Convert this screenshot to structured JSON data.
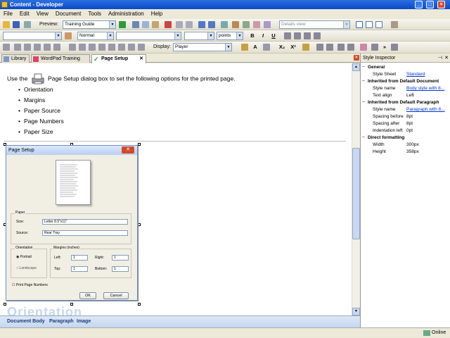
{
  "window": {
    "title": "Content - Developer"
  },
  "menu": [
    "File",
    "Edit",
    "View",
    "Document",
    "Tools",
    "Administration",
    "Help"
  ],
  "toolbar1": {
    "preview_label": "Preview:",
    "preview_value": "Training Guide",
    "view_value": "Details view"
  },
  "toolbar2": {
    "font_combo": "",
    "style_value": "Normal",
    "size_unit": "points"
  },
  "toolbar3": {
    "display_label": "Display:",
    "display_value": "Player",
    "bold": "B",
    "italic": "I",
    "underline": "U",
    "subscript": "X₂",
    "superscript": "X²"
  },
  "tabs": [
    {
      "label": "Library",
      "icon": "library-icon"
    },
    {
      "label": "WordPad Training",
      "icon": "wordpad-icon"
    },
    {
      "label": "Page Setup",
      "icon": "check-icon",
      "active": true
    }
  ],
  "document": {
    "intro_before": "Use the",
    "intro_after": "Page Setup dialog box to set the following options for the printed page.",
    "options": [
      "Orientation",
      "Margins",
      "Paper Source",
      "Page Numbers",
      "Paper Size"
    ],
    "next_heading": "Orientation"
  },
  "dialog": {
    "title": "Page Setup",
    "paper_group": "Paper",
    "size_label": "Size:",
    "size_value": "Letter 8.5\"x11\"",
    "source_label": "Source:",
    "source_value": "Rear Tray",
    "orientation_group": "Orientation",
    "portrait": "Portrait",
    "landscape": "Landscape",
    "margins_group": "Margins (inches)",
    "left_label": "Left:",
    "left_value": "1",
    "right_label": "Right:",
    "right_value": "1",
    "top_label": "Top:",
    "top_value": "1",
    "bottom_label": "Bottom:",
    "bottom_value": "1",
    "print_numbers": "Print Page Numbers",
    "ok": "OK",
    "cancel": "Cancel"
  },
  "doc_status": [
    "Document Body",
    "Paragraph",
    "Image"
  ],
  "inspector": {
    "title": "Style Inspector",
    "rows": [
      {
        "type": "h",
        "text": "General"
      },
      {
        "type": "kv",
        "k": "Style Sheet",
        "v": "Standard",
        "link": true
      },
      {
        "type": "h",
        "text": "Inherited from Default Document"
      },
      {
        "type": "kv",
        "k": "Style name",
        "v": "Body style with 8...",
        "link": true
      },
      {
        "type": "kv",
        "k": "Text align",
        "v": "Left"
      },
      {
        "type": "h",
        "text": "Inherited from Default Paragraph"
      },
      {
        "type": "kv",
        "k": "Style name",
        "v": "Paragraph with 8...",
        "link": true
      },
      {
        "type": "kv",
        "k": "Spacing before",
        "v": "8pt"
      },
      {
        "type": "kv",
        "k": "Spacing after",
        "v": "8pt"
      },
      {
        "type": "kv",
        "k": "Indentation left",
        "v": "0pt"
      },
      {
        "type": "h",
        "text": "Direct formatting"
      },
      {
        "type": "kv",
        "k": "Width",
        "v": "300px"
      },
      {
        "type": "kv",
        "k": "Height",
        "v": "358px"
      }
    ]
  },
  "status": {
    "online": "Online"
  }
}
